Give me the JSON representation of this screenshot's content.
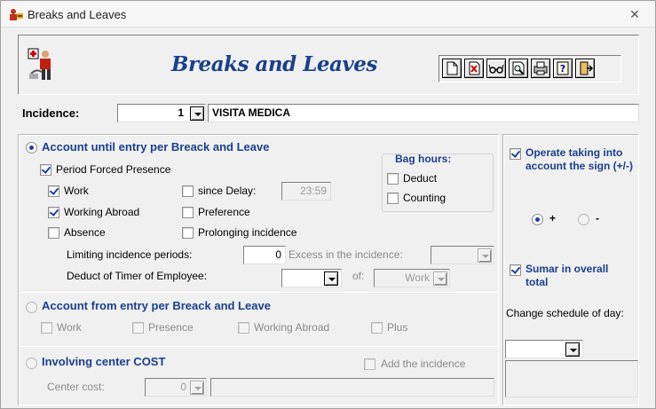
{
  "window": {
    "title": "Breaks and Leaves",
    "close_icon": "close-x-icon"
  },
  "header": {
    "title": "Breaks and Leaves",
    "icon": "doctor-patient-icon",
    "toolbar": [
      {
        "name": "new-document-icon"
      },
      {
        "name": "delete-icon"
      },
      {
        "name": "view-glasses-icon"
      },
      {
        "name": "print-preview-icon"
      },
      {
        "name": "print-icon"
      },
      {
        "name": "help-icon"
      },
      {
        "name": "exit-icon"
      }
    ]
  },
  "incidence": {
    "label": "Incidence:",
    "code": "1",
    "description": "VISITA MEDICA"
  },
  "section1": {
    "title": "Account until entry per Breack and Leave",
    "period_forced": "Period Forced Presence",
    "work": "Work",
    "working_abroad": "Working Abroad",
    "absence": "Absence",
    "since_delay": "since Delay:",
    "since_delay_value": "23:59",
    "preference": "Preference",
    "prolonging": "Prolonging incidence",
    "limiting_label": "Limiting incidence periods:",
    "limiting_value": "0",
    "excess_label": "Excess in the incidence:",
    "deduct_timer_label": "Deduct of Timer of Employee:",
    "of_label": "of:",
    "of_value": "Work"
  },
  "bag_hours": {
    "title": "Bag hours:",
    "deduct": "Deduct",
    "counting": "Counting"
  },
  "section2": {
    "title": "Account from entry per Breack and Leave",
    "work": "Work",
    "presence": "Presence",
    "working_abroad": "Working Abroad",
    "plus": "Plus"
  },
  "section3": {
    "title": "Involving center COST",
    "add_incidence": "Add the incidence",
    "center_cost_label": "Center cost:",
    "center_cost_value": "0"
  },
  "right_panel": {
    "operate_sign": "Operate taking into account the sign (+/-)",
    "plus": "+",
    "minus": "-",
    "sumar": "Sumar in overall total",
    "change_schedule": "Change schedule of day:"
  }
}
